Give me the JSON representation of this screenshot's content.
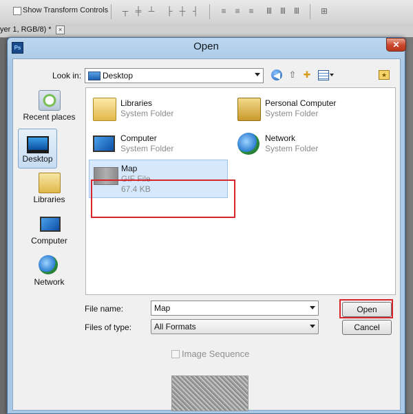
{
  "background": {
    "toolbar": {
      "show_transform_label": "Show Transform Controls",
      "icons": [
        "align-top-icon",
        "align-vcenter-icon",
        "align-bottom-icon",
        "align-left-icon",
        "align-hcenter-icon",
        "align-right-icon",
        "distribute-top-icon",
        "distribute-vcenter-icon",
        "distribute-bottom-icon",
        "distribute-left-icon",
        "distribute-hcenter-icon",
        "distribute-right-icon",
        "auto-align-icon"
      ]
    },
    "doc_tab": {
      "label": "yer 1, RGB/8) *",
      "close_glyph": "×"
    }
  },
  "dialog": {
    "title": "Open",
    "app_icon_text": "Ps",
    "close_glyph": "✕",
    "look_in": {
      "label": "Look in:",
      "value": "Desktop"
    },
    "places": [
      {
        "label": "Recent places",
        "icon": "recent-places-icon"
      },
      {
        "label": "Desktop",
        "icon": "desktop-icon",
        "selected": true
      },
      {
        "label": "Libraries",
        "icon": "libraries-icon"
      },
      {
        "label": "Computer",
        "icon": "computer-icon"
      },
      {
        "label": "Network",
        "icon": "network-icon"
      }
    ],
    "files": [
      {
        "name": "Libraries",
        "type": "System Folder",
        "icon": "folder-icon"
      },
      {
        "name": "Personal Computer",
        "type": "System Folder",
        "icon": "user-folder-icon"
      },
      {
        "name": "Computer",
        "type": "System Folder",
        "icon": "computer-icon"
      },
      {
        "name": "Network",
        "type": "System Folder",
        "icon": "network-icon"
      },
      {
        "name": "Map",
        "type": "GIF File",
        "size": "67.4 KB",
        "icon": "gif-file-icon",
        "selected": true
      }
    ],
    "file_name": {
      "label": "File name:",
      "value": "Map"
    },
    "file_type": {
      "label": "Files of type:",
      "value": "All Formats"
    },
    "buttons": {
      "open": "Open",
      "cancel": "Cancel"
    },
    "image_sequence": {
      "label": "Image Sequence",
      "checked": false,
      "enabled": false
    },
    "highlight_color": "#d8232a"
  }
}
